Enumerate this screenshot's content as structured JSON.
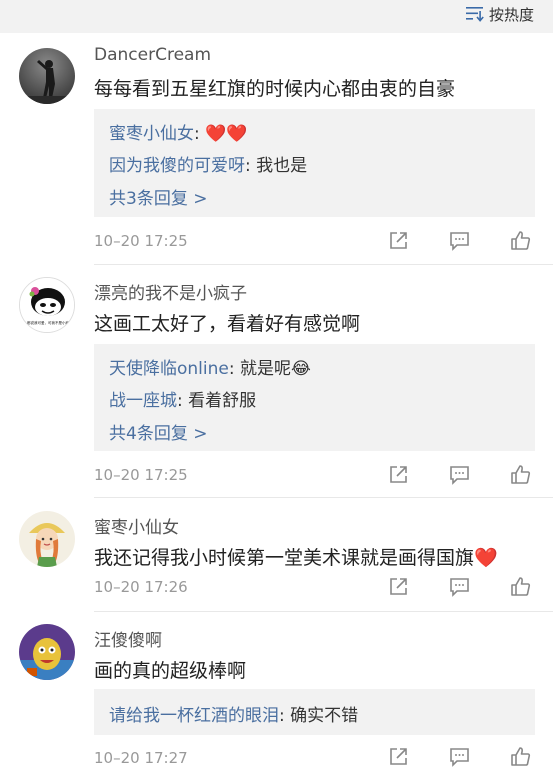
{
  "header": {
    "sort_label": "按热度"
  },
  "comments": [
    {
      "username": "DancerCream",
      "content": "每每看到五星红旗的时候内心都由衷的自豪",
      "replies": [
        {
          "name": "蜜枣小仙女",
          "text": "❤️❤️"
        },
        {
          "name": "因为我傻的可爱呀",
          "text": "我也是"
        }
      ],
      "more": "共3条回复 >",
      "time": "10–20 17:25"
    },
    {
      "username": "漂亮的我不是小疯子",
      "content": "这画工太好了，看着好有感觉啊",
      "avatar_text": "人都说我可爱，可我不是小疯子",
      "replies": [
        {
          "name": "天使降临online",
          "text": "就是呢😂"
        },
        {
          "name": "战一座城",
          "text": "看着舒服"
        }
      ],
      "more": "共4条回复 >",
      "time": "10–20 17:25"
    },
    {
      "username": "蜜枣小仙女",
      "content": "我还记得我小时候第一堂美术课就是画得国旗",
      "content_emoji": "❤️",
      "time": "10–20 17:26"
    },
    {
      "username": "汪傻傻啊",
      "content": "画的真的超级棒啊",
      "replies": [
        {
          "name": "请给我一杯红酒的眼泪",
          "text": "确实不错"
        }
      ],
      "time": "10–20 17:27"
    }
  ],
  "icons": {
    "sort": "sort-icon",
    "share": "share-icon",
    "reply": "comment-icon",
    "like": "thumbs-up-icon"
  },
  "colors": {
    "link": "#4a6fa0",
    "heart": "#e8322c",
    "reply_bg": "#f2f2f2"
  }
}
